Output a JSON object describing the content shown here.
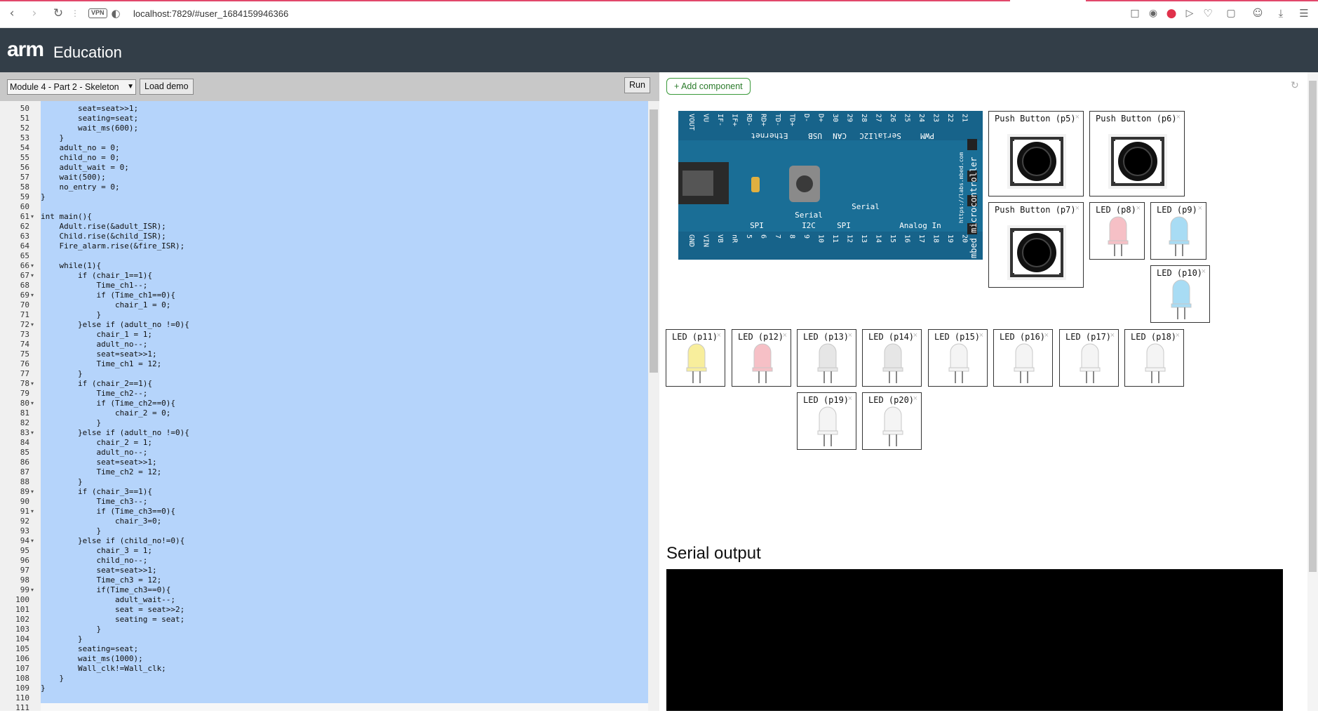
{
  "browser": {
    "url": "localhost:7829/#user_1684159946366",
    "vpn_label": "VPN"
  },
  "header": {
    "logo_arm": "arm",
    "logo_edu": "Education"
  },
  "toolbar": {
    "module_select_value": "Module 4 - Part 2 - Skeleton",
    "load_demo_label": "Load demo",
    "run_label": "Run"
  },
  "editor": {
    "lines": [
      {
        "n": "50",
        "t": "        seat=seat>>1;"
      },
      {
        "n": "51",
        "t": "        seating=seat;"
      },
      {
        "n": "52",
        "t": "        wait_ms(600);"
      },
      {
        "n": "53",
        "t": "    }"
      },
      {
        "n": "54",
        "t": "    adult_no = 0;"
      },
      {
        "n": "55",
        "t": "    child_no = 0;"
      },
      {
        "n": "56",
        "t": "    adult_wait = 0;"
      },
      {
        "n": "57",
        "t": "    wait(500);"
      },
      {
        "n": "58",
        "t": "    no_entry = 0;"
      },
      {
        "n": "59",
        "t": "}"
      },
      {
        "n": "60",
        "t": ""
      },
      {
        "n": "61",
        "t": "int main(){",
        "fold": true
      },
      {
        "n": "62",
        "t": "    Adult.rise(&adult_ISR);"
      },
      {
        "n": "63",
        "t": "    Child.rise(&child_ISR);"
      },
      {
        "n": "64",
        "t": "    Fire_alarm.rise(&fire_ISR);"
      },
      {
        "n": "65",
        "t": ""
      },
      {
        "n": "66",
        "t": "    while(1){",
        "fold": true
      },
      {
        "n": "67",
        "t": "        if (chair_1==1){",
        "fold": true
      },
      {
        "n": "68",
        "t": "            Time_ch1--;"
      },
      {
        "n": "69",
        "t": "            if (Time_ch1==0){",
        "fold": true
      },
      {
        "n": "70",
        "t": "                chair_1 = 0;"
      },
      {
        "n": "71",
        "t": "            }"
      },
      {
        "n": "72",
        "t": "        }else if (adult_no !=0){",
        "fold": true
      },
      {
        "n": "73",
        "t": "            chair_1 = 1;"
      },
      {
        "n": "74",
        "t": "            adult_no--;"
      },
      {
        "n": "75",
        "t": "            seat=seat>>1;"
      },
      {
        "n": "76",
        "t": "            Time_ch1 = 12;"
      },
      {
        "n": "77",
        "t": "        }"
      },
      {
        "n": "78",
        "t": "        if (chair_2==1){",
        "fold": true
      },
      {
        "n": "79",
        "t": "            Time_ch2--;"
      },
      {
        "n": "80",
        "t": "            if (Time_ch2==0){",
        "fold": true
      },
      {
        "n": "81",
        "t": "                chair_2 = 0;"
      },
      {
        "n": "82",
        "t": "            }"
      },
      {
        "n": "83",
        "t": "        }else if (adult_no !=0){",
        "fold": true
      },
      {
        "n": "84",
        "t": "            chair_2 = 1;"
      },
      {
        "n": "85",
        "t": "            adult_no--;"
      },
      {
        "n": "86",
        "t": "            seat=seat>>1;"
      },
      {
        "n": "87",
        "t": "            Time_ch2 = 12;"
      },
      {
        "n": "88",
        "t": "        }"
      },
      {
        "n": "89",
        "t": "        if (chair_3==1){",
        "fold": true
      },
      {
        "n": "90",
        "t": "            Time_ch3--;"
      },
      {
        "n": "91",
        "t": "            if (Time_ch3==0){",
        "fold": true
      },
      {
        "n": "92",
        "t": "                chair_3=0;"
      },
      {
        "n": "93",
        "t": "            }"
      },
      {
        "n": "94",
        "t": "        }else if (child_no!=0){",
        "fold": true
      },
      {
        "n": "95",
        "t": "            chair_3 = 1;"
      },
      {
        "n": "96",
        "t": "            child_no--;"
      },
      {
        "n": "97",
        "t": "            seat=seat>>1;"
      },
      {
        "n": "98",
        "t": "            Time_ch3 = 12;"
      },
      {
        "n": "99",
        "t": "            if(Time_ch3==0){",
        "fold": true
      },
      {
        "n": "100",
        "t": "                adult_wait--;"
      },
      {
        "n": "101",
        "t": "                seat = seat>>2;"
      },
      {
        "n": "102",
        "t": "                seating = seat;"
      },
      {
        "n": "103",
        "t": "            }"
      },
      {
        "n": "104",
        "t": "        }"
      },
      {
        "n": "105",
        "t": "        seating=seat;"
      },
      {
        "n": "106",
        "t": "        wait_ms(1000);"
      },
      {
        "n": "107",
        "t": "        Wall_clk!=Wall_clk;"
      },
      {
        "n": "108",
        "t": "    }"
      },
      {
        "n": "109",
        "t": "}"
      },
      {
        "n": "110",
        "t": ""
      },
      {
        "n": "111",
        "t": ""
      }
    ]
  },
  "simulator": {
    "add_component_label": "+ Add component",
    "board": {
      "top_pins": [
        "VOUT",
        "VU",
        "IF-",
        "IF+",
        "RD-",
        "RD+",
        "TD-",
        "TD+",
        "D-",
        "D+",
        "30",
        "29",
        "28",
        "27",
        "26",
        "25",
        "24",
        "23",
        "22",
        "21"
      ],
      "bottom_pins": [
        "GND",
        "VIN",
        "VB",
        "nR",
        "5",
        "6",
        "7",
        "8",
        "9",
        "10",
        "11",
        "12",
        "13",
        "14",
        "15",
        "16",
        "17",
        "18",
        "19",
        "20"
      ],
      "top_labels": [
        "Ethernet",
        "USB",
        "CAN",
        "I2C",
        "Serial",
        "PWM"
      ],
      "bottom_labels": [
        "SPI",
        "Serial",
        "I2C",
        "SPI",
        "Serial",
        "Analog In"
      ],
      "side_text": "mbed microcontroller",
      "side_url": "https://labs.mbed.com"
    },
    "buttons": [
      {
        "label": "Push Button (p5)"
      },
      {
        "label": "Push Button (p6)"
      },
      {
        "label": "Push Button (p7)"
      }
    ],
    "leds": [
      {
        "label": "LED (p8)",
        "color": "#f6c0c6"
      },
      {
        "label": "LED (p9)",
        "color": "#a8dcf4"
      },
      {
        "label": "LED (p10)",
        "color": "#a8dcf4"
      },
      {
        "label": "LED (p11)",
        "color": "#f8ee9c"
      },
      {
        "label": "LED (p12)",
        "color": "#f6c0c6"
      },
      {
        "label": "LED (p13)",
        "color": "#e6e6e6"
      },
      {
        "label": "LED (p14)",
        "color": "#e6e6e6"
      },
      {
        "label": "LED (p15)",
        "color": "#f4f4f4"
      },
      {
        "label": "LED (p16)",
        "color": "#f4f4f4"
      },
      {
        "label": "LED (p17)",
        "color": "#f4f4f4"
      },
      {
        "label": "LED (p18)",
        "color": "#f4f4f4"
      },
      {
        "label": "LED (p19)",
        "color": "#f4f4f4"
      },
      {
        "label": "LED (p20)",
        "color": "#f4f4f4"
      }
    ],
    "serial_title": "Serial output"
  },
  "colors": {
    "header_bg": "#333e48",
    "selection": "#b5d4fb",
    "board_blue": "#1a6e96"
  }
}
